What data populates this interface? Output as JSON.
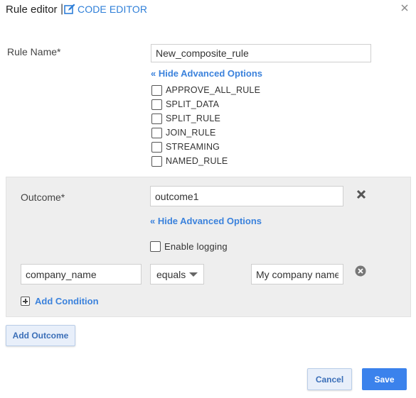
{
  "header": {
    "title": "Rule editor",
    "separator": "|",
    "code_editor_label": "CODE EDITOR"
  },
  "rule": {
    "name_label": "Rule Name*",
    "name_value": "New_composite_rule",
    "hide_advanced_label": "« Hide Advanced Options",
    "options": [
      {
        "label": "APPROVE_ALL_RULE",
        "checked": false
      },
      {
        "label": "SPLIT_DATA",
        "checked": false
      },
      {
        "label": "SPLIT_RULE",
        "checked": false
      },
      {
        "label": "JOIN_RULE",
        "checked": false
      },
      {
        "label": "STREAMING",
        "checked": false
      },
      {
        "label": "NAMED_RULE",
        "checked": false
      }
    ]
  },
  "outcome": {
    "label": "Outcome*",
    "value": "outcome1",
    "hide_advanced_label": "« Hide Advanced Options",
    "enable_logging_label": "Enable logging",
    "enable_logging_checked": false,
    "condition": {
      "field": "company_name",
      "operator": "equals",
      "value": "My company name"
    },
    "add_condition_label": "Add Condition"
  },
  "buttons": {
    "add_outcome": "Add Outcome",
    "cancel": "Cancel",
    "save": "Save"
  },
  "colors": {
    "accent": "#3b82dc",
    "primary_button": "#3b82ec",
    "panel_bg": "#eeeeee"
  },
  "icons": {
    "code_editor": "edit-icon",
    "close": "close-icon",
    "remove_outcome": "remove-x-icon",
    "remove_condition": "circle-x-icon",
    "add_condition": "plus-box-icon",
    "select_caret": "caret-down-icon"
  }
}
